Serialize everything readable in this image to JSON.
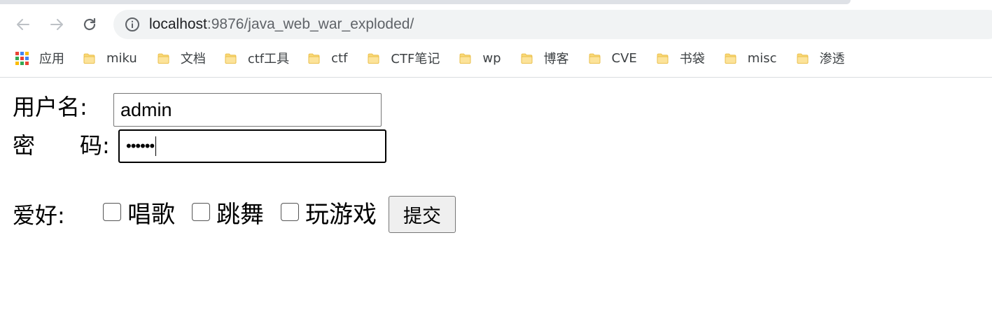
{
  "browser": {
    "url_host": "localhost",
    "url_rest": ":9876/java_web_war_exploded/",
    "icons": {
      "back": "arrow-left-icon",
      "forward": "arrow-right-icon",
      "reload": "reload-icon",
      "site_info": "info-icon"
    }
  },
  "bookmarks": {
    "apps_label": "应用",
    "apps_colors": [
      "#ea4335",
      "#4285f4",
      "#fbbc05",
      "#34a853",
      "#ea4335",
      "#4285f4",
      "#fbbc05",
      "#34a853",
      "#ea4335"
    ],
    "folder_color": "#f9d877",
    "items": [
      {
        "label": "miku"
      },
      {
        "label": "文档"
      },
      {
        "label": "ctf工具"
      },
      {
        "label": "ctf"
      },
      {
        "label": "CTF笔记"
      },
      {
        "label": "wp"
      },
      {
        "label": "博客"
      },
      {
        "label": "CVE"
      },
      {
        "label": "书袋"
      },
      {
        "label": "misc"
      },
      {
        "label": "渗透"
      }
    ]
  },
  "form": {
    "username_label": "用户名:",
    "username_value": "admin",
    "password_label": "密  码:",
    "password_masked": "••••••",
    "hobby_label": "爱好:",
    "hobbies": [
      {
        "label": "唱歌",
        "checked": false
      },
      {
        "label": "跳舞",
        "checked": false
      },
      {
        "label": "玩游戏",
        "checked": false
      }
    ],
    "submit_label": "提交"
  }
}
